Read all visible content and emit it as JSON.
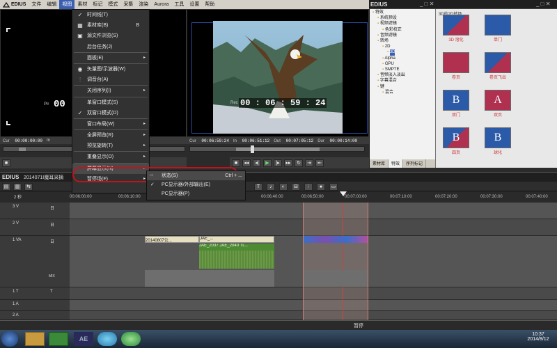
{
  "app": {
    "name": "EDIUS"
  },
  "menubar": [
    "文件",
    "编辑",
    "视图",
    "素材",
    "标记",
    "模式",
    "采集",
    "渲染",
    "Aurora",
    "工具",
    "设置",
    "帮助"
  ],
  "view_menu": {
    "items": [
      {
        "label": "时间线(T)",
        "check": "✓"
      },
      {
        "label": "素材库(B)",
        "shortcut": "B"
      },
      {
        "label": "源文件浏览(S)"
      },
      {
        "label": "后台任务(J)"
      },
      {
        "label": "面板(E)",
        "arrow": "▸"
      },
      {
        "label": "矢量图/示波器(W)"
      },
      {
        "label": "调音台(A)"
      },
      {
        "label": "关闭序列(I)",
        "arrow": "▸"
      },
      {
        "label": "单窗口模式(S)"
      },
      {
        "label": "双窗口模式(D)",
        "check": "✓"
      },
      {
        "label": "窗口布局(W)",
        "arrow": "▸"
      },
      {
        "label": "全屏预览(R)",
        "arrow": "▸"
      },
      {
        "label": "预览旋转(T)",
        "arrow": "▸"
      },
      {
        "label": "重叠显示(O)",
        "arrow": "▸"
      },
      {
        "label": "屏幕显示(N)",
        "arrow": "▸"
      },
      {
        "label": "暂停场(F)",
        "arrow": "▸"
      }
    ]
  },
  "submenu": {
    "items": [
      {
        "label": "状态(S)",
        "shortcut": "Ctrl + ..."
      },
      {
        "label": "PC显示器/外部输出(E)",
        "check": "✓"
      },
      {
        "label": "PC显示器(P)"
      }
    ]
  },
  "player": {
    "plr_label": "Plr",
    "plr_tc": "00 :00",
    "cur_label": "Cur",
    "cur_tc": "00:00:00:00",
    "in_label": "In"
  },
  "recorder": {
    "rec_label": "Rec",
    "rec_tc": "00 : 06 : 59 : 24",
    "cur_label": "Cur",
    "cur_tc": "00:06:59:24",
    "in_label": "In",
    "in_tc": "00:06:51:12",
    "out_label": "Out",
    "out_tc": "00:07:05:12",
    "dur_label": "Dur",
    "dur_tc": "00:00:14:00"
  },
  "effects_panel": {
    "title": "特效",
    "tree": [
      "特效",
      "系统预设",
      "视频滤镜",
      "色彩校正",
      "音频滤镜",
      "转场",
      "2D",
      "3D",
      "Alpha",
      "GPU",
      "SMPTE",
      "音频淡入淡出",
      "字幕混合",
      "键",
      "混合"
    ],
    "tabs": [
      "素材库",
      "特效",
      "序列标记"
    ]
  },
  "thumbs_panel": {
    "header": "3D的2D转场",
    "items": [
      "3D 溶化",
      "单门",
      "卷页",
      "卷页飞出",
      "双门",
      "双页",
      "四页",
      "球化"
    ]
  },
  "timeline": {
    "sequence_tab": "2014071I魔耳采摘",
    "zoom": "2 秒",
    "ruler": [
      "00:06:00:00",
      "00:06:10:00",
      "00:06:40:00",
      "00:06:50:00",
      "00:07:00:00",
      "00:07:10:00",
      "00:07:20:00",
      "00:07:30:00",
      "00:07:40:00"
    ],
    "tracks": [
      {
        "name": "3 V",
        "tag": "日"
      },
      {
        "name": "2 V",
        "tag": "日"
      },
      {
        "name": "1 VA",
        "tag": "日"
      },
      {
        "name": "1 T",
        "tag": "T"
      },
      {
        "name": "1 A",
        "tag": ""
      },
      {
        "name": "2 A",
        "tag": ""
      }
    ],
    "mix_label": "MIX",
    "clips": [
      "20140807公...",
      "JAE_...",
      "JAE_2037",
      "JAE_2040",
      "TL..."
    ]
  },
  "status": {
    "text": "暂停"
  },
  "taskbar": {
    "time": "10:37",
    "date": "2014/8/12",
    "app_icon": "AE"
  },
  "colors": {
    "accent": "#3a5fb0",
    "highlight_ring": "#c0141c",
    "clip_blue": "#3a6fc8",
    "clip_audio": "#5b8a3a"
  }
}
